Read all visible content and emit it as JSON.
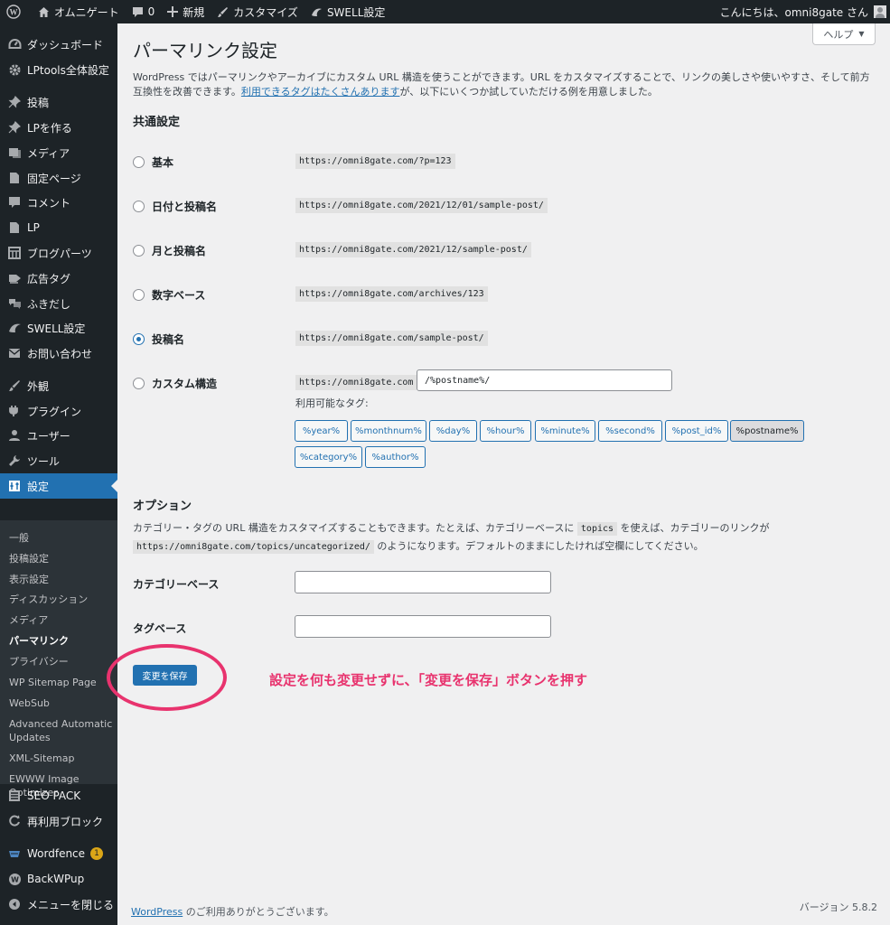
{
  "adminbar": {
    "site_name": "オムニゲート",
    "comments_count": "0",
    "new_label": "新規",
    "customize_label": "カスタマイズ",
    "swell_label": "SWELL設定",
    "greeting": "こんにちは、omni8gate さん"
  },
  "sidebar": {
    "items": [
      {
        "label": "ダッシュボード",
        "icon": "dashboard-icon"
      },
      {
        "label": "LPtools全体設定",
        "icon": "gear-icon"
      },
      {
        "label": "投稿",
        "icon": "pin-icon"
      },
      {
        "label": "LPを作る",
        "icon": "pin-icon"
      },
      {
        "label": "メディア",
        "icon": "media-icon"
      },
      {
        "label": "固定ページ",
        "icon": "page-icon"
      },
      {
        "label": "コメント",
        "icon": "comment-icon"
      },
      {
        "label": "LP",
        "icon": "page-icon"
      },
      {
        "label": "ブログパーツ",
        "icon": "grid-icon"
      },
      {
        "label": "広告タグ",
        "icon": "tag-icon"
      },
      {
        "label": "ふきだし",
        "icon": "bubble-icon"
      },
      {
        "label": "SWELL設定",
        "icon": "swell-icon"
      },
      {
        "label": "お問い合わせ",
        "icon": "mail-icon"
      },
      {
        "label": "外観",
        "icon": "brush-icon"
      },
      {
        "label": "プラグイン",
        "icon": "plugin-icon"
      },
      {
        "label": "ユーザー",
        "icon": "user-icon"
      },
      {
        "label": "ツール",
        "icon": "wrench-icon"
      },
      {
        "label": "設定",
        "icon": "settings-icon"
      },
      {
        "label": "SEO PACK",
        "icon": "list-icon"
      },
      {
        "label": "再利用ブロック",
        "icon": "reuse-icon"
      },
      {
        "label": "Wordfence",
        "icon": "wordfence-icon",
        "badge": "1"
      },
      {
        "label": "BackWPup",
        "icon": "backwpup-icon"
      },
      {
        "label": "メニューを閉じる",
        "icon": "collapse-icon"
      }
    ],
    "submenu": [
      "一般",
      "投稿設定",
      "表示設定",
      "ディスカッション",
      "メディア",
      "パーマリンク",
      "プライバシー",
      "WP Sitemap Page",
      "WebSub",
      "Advanced Automatic Updates",
      "XML-Sitemap",
      "EWWW Image Optimizer"
    ]
  },
  "main": {
    "title": "パーマリンク設定",
    "help_label": "ヘルプ",
    "description_prefix": "WordPress ではパーマリンクやアーカイブにカスタム URL 構造を使うことができます。URL をカスタマイズすることで、リンクの美しさや使いやすさ、そして前方互換性を改善できます。",
    "description_link": "利用できるタグはたくさんあります",
    "description_suffix": "が、以下にいくつか試していただける例を用意しました。",
    "common_heading": "共通設定",
    "options": [
      {
        "label": "基本",
        "url": "https://omni8gate.com/?p=123",
        "checked": false
      },
      {
        "label": "日付と投稿名",
        "url": "https://omni8gate.com/2021/12/01/sample-post/",
        "checked": false
      },
      {
        "label": "月と投稿名",
        "url": "https://omni8gate.com/2021/12/sample-post/",
        "checked": false
      },
      {
        "label": "数字ベース",
        "url": "https://omni8gate.com/archives/123",
        "checked": false
      },
      {
        "label": "投稿名",
        "url": "https://omni8gate.com/sample-post/",
        "checked": true
      },
      {
        "label": "カスタム構造",
        "url": "https://omni8gate.com",
        "checked": false
      }
    ],
    "custom_structure_value": "/%postname%/",
    "available_tags_label": "利用可能なタグ:",
    "tags": [
      "%year%",
      "%monthnum%",
      "%day%",
      "%hour%",
      "%minute%",
      "%second%",
      "%post_id%",
      "%postname%",
      "%category%",
      "%author%"
    ],
    "options_heading": "オプション",
    "options_desc_1": "カテゴリー・タグの URL 構造をカスタマイズすることもできます。たとえば、カテゴリーベースに",
    "options_desc_code1": "topics",
    "options_desc_2": "を使えば、カテゴリーのリンクが",
    "options_desc_code2": "https://omni8gate.com/topics/uncategorized/",
    "options_desc_3": "のようになります。デフォルトのままにしたければ空欄にしてください。",
    "category_base_label": "カテゴリーベース",
    "category_base_value": "",
    "tag_base_label": "タグベース",
    "tag_base_value": "",
    "save_label": "変更を保存",
    "annotation": "設定を何も変更せずに、「変更を保存」ボタンを押す",
    "footer_link": "WordPress",
    "footer_text": " のご利用ありがとうございます。",
    "version": "バージョン 5.8.2"
  },
  "colors": {
    "admin_dark": "#1d2327",
    "accent": "#2271b1",
    "annotation": "#e8336e",
    "background": "#f0f0f1"
  }
}
